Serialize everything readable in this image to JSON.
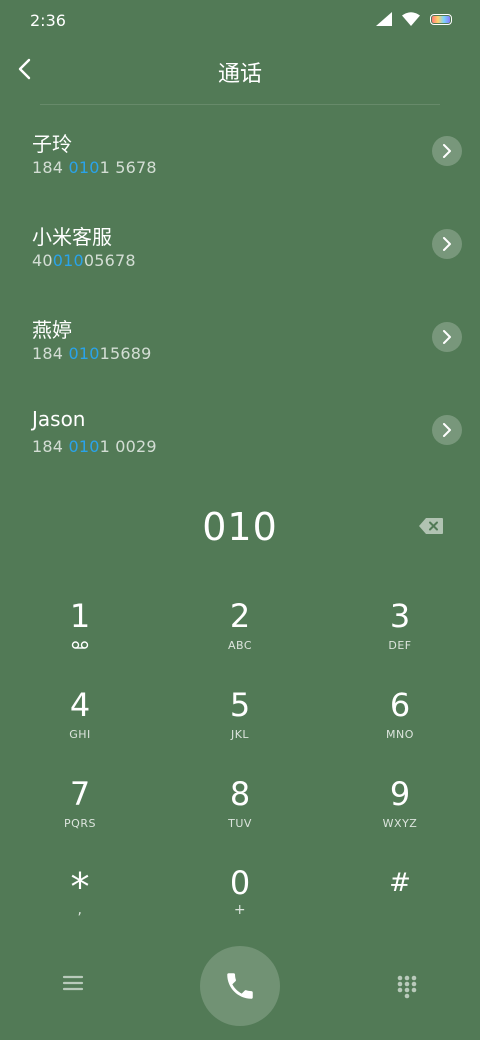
{
  "status": {
    "time": "2:36"
  },
  "header": {
    "title": "通话"
  },
  "contacts": [
    {
      "name": "子玲",
      "number_pre": "184 ",
      "number_match": "010",
      "number_post": "1 5678"
    },
    {
      "name": "小米客服",
      "number_pre": "40",
      "number_match": "010",
      "number_post": "05678"
    },
    {
      "name": "燕婷",
      "number_pre": "184 ",
      "number_match": "010",
      "number_post": "15689"
    },
    {
      "name": "Jason",
      "number_pre": "184 ",
      "number_match": "010",
      "number_post": "1 0029"
    }
  ],
  "dialer": {
    "input": "010"
  },
  "keypad": {
    "k1": {
      "digit": "1",
      "letters": ""
    },
    "k2": {
      "digit": "2",
      "letters": "ABC"
    },
    "k3": {
      "digit": "3",
      "letters": "DEF"
    },
    "k4": {
      "digit": "4",
      "letters": "GHI"
    },
    "k5": {
      "digit": "5",
      "letters": "JKL"
    },
    "k6": {
      "digit": "6",
      "letters": "MNO"
    },
    "k7": {
      "digit": "7",
      "letters": "PQRS"
    },
    "k8": {
      "digit": "8",
      "letters": "TUV"
    },
    "k9": {
      "digit": "9",
      "letters": "WXYZ"
    },
    "kstar": {
      "digit": "*",
      "letters": ","
    },
    "k0": {
      "digit": "0",
      "letters": "+"
    },
    "khash": {
      "digit": "#",
      "letters": ""
    }
  },
  "icons": {
    "back": "chevron-left-icon",
    "detail": "chevron-right-icon",
    "backspace": "backspace-icon",
    "menu": "menu-icon",
    "call": "phone-icon",
    "keypad_toggle": "dialpad-icon"
  },
  "colors": {
    "background": "#527a56",
    "highlight": "#2aa3ea"
  }
}
